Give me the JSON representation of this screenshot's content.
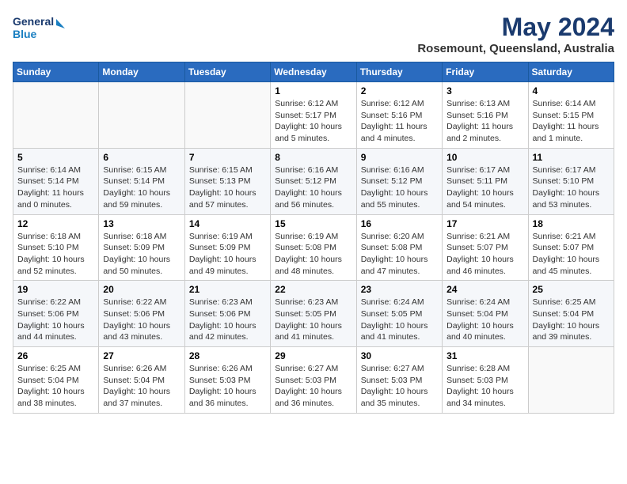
{
  "header": {
    "logo_line1": "General",
    "logo_line2": "Blue",
    "month_year": "May 2024",
    "location": "Rosemount, Queensland, Australia"
  },
  "days_of_week": [
    "Sunday",
    "Monday",
    "Tuesday",
    "Wednesday",
    "Thursday",
    "Friday",
    "Saturday"
  ],
  "weeks": [
    [
      {
        "day": "",
        "info": ""
      },
      {
        "day": "",
        "info": ""
      },
      {
        "day": "",
        "info": ""
      },
      {
        "day": "1",
        "info": "Sunrise: 6:12 AM\nSunset: 5:17 PM\nDaylight: 10 hours\nand 5 minutes."
      },
      {
        "day": "2",
        "info": "Sunrise: 6:12 AM\nSunset: 5:16 PM\nDaylight: 11 hours\nand 4 minutes."
      },
      {
        "day": "3",
        "info": "Sunrise: 6:13 AM\nSunset: 5:16 PM\nDaylight: 11 hours\nand 2 minutes."
      },
      {
        "day": "4",
        "info": "Sunrise: 6:14 AM\nSunset: 5:15 PM\nDaylight: 11 hours\nand 1 minute."
      }
    ],
    [
      {
        "day": "5",
        "info": "Sunrise: 6:14 AM\nSunset: 5:14 PM\nDaylight: 11 hours\nand 0 minutes."
      },
      {
        "day": "6",
        "info": "Sunrise: 6:15 AM\nSunset: 5:14 PM\nDaylight: 10 hours\nand 59 minutes."
      },
      {
        "day": "7",
        "info": "Sunrise: 6:15 AM\nSunset: 5:13 PM\nDaylight: 10 hours\nand 57 minutes."
      },
      {
        "day": "8",
        "info": "Sunrise: 6:16 AM\nSunset: 5:12 PM\nDaylight: 10 hours\nand 56 minutes."
      },
      {
        "day": "9",
        "info": "Sunrise: 6:16 AM\nSunset: 5:12 PM\nDaylight: 10 hours\nand 55 minutes."
      },
      {
        "day": "10",
        "info": "Sunrise: 6:17 AM\nSunset: 5:11 PM\nDaylight: 10 hours\nand 54 minutes."
      },
      {
        "day": "11",
        "info": "Sunrise: 6:17 AM\nSunset: 5:10 PM\nDaylight: 10 hours\nand 53 minutes."
      }
    ],
    [
      {
        "day": "12",
        "info": "Sunrise: 6:18 AM\nSunset: 5:10 PM\nDaylight: 10 hours\nand 52 minutes."
      },
      {
        "day": "13",
        "info": "Sunrise: 6:18 AM\nSunset: 5:09 PM\nDaylight: 10 hours\nand 50 minutes."
      },
      {
        "day": "14",
        "info": "Sunrise: 6:19 AM\nSunset: 5:09 PM\nDaylight: 10 hours\nand 49 minutes."
      },
      {
        "day": "15",
        "info": "Sunrise: 6:19 AM\nSunset: 5:08 PM\nDaylight: 10 hours\nand 48 minutes."
      },
      {
        "day": "16",
        "info": "Sunrise: 6:20 AM\nSunset: 5:08 PM\nDaylight: 10 hours\nand 47 minutes."
      },
      {
        "day": "17",
        "info": "Sunrise: 6:21 AM\nSunset: 5:07 PM\nDaylight: 10 hours\nand 46 minutes."
      },
      {
        "day": "18",
        "info": "Sunrise: 6:21 AM\nSunset: 5:07 PM\nDaylight: 10 hours\nand 45 minutes."
      }
    ],
    [
      {
        "day": "19",
        "info": "Sunrise: 6:22 AM\nSunset: 5:06 PM\nDaylight: 10 hours\nand 44 minutes."
      },
      {
        "day": "20",
        "info": "Sunrise: 6:22 AM\nSunset: 5:06 PM\nDaylight: 10 hours\nand 43 minutes."
      },
      {
        "day": "21",
        "info": "Sunrise: 6:23 AM\nSunset: 5:06 PM\nDaylight: 10 hours\nand 42 minutes."
      },
      {
        "day": "22",
        "info": "Sunrise: 6:23 AM\nSunset: 5:05 PM\nDaylight: 10 hours\nand 41 minutes."
      },
      {
        "day": "23",
        "info": "Sunrise: 6:24 AM\nSunset: 5:05 PM\nDaylight: 10 hours\nand 41 minutes."
      },
      {
        "day": "24",
        "info": "Sunrise: 6:24 AM\nSunset: 5:04 PM\nDaylight: 10 hours\nand 40 minutes."
      },
      {
        "day": "25",
        "info": "Sunrise: 6:25 AM\nSunset: 5:04 PM\nDaylight: 10 hours\nand 39 minutes."
      }
    ],
    [
      {
        "day": "26",
        "info": "Sunrise: 6:25 AM\nSunset: 5:04 PM\nDaylight: 10 hours\nand 38 minutes."
      },
      {
        "day": "27",
        "info": "Sunrise: 6:26 AM\nSunset: 5:04 PM\nDaylight: 10 hours\nand 37 minutes."
      },
      {
        "day": "28",
        "info": "Sunrise: 6:26 AM\nSunset: 5:03 PM\nDaylight: 10 hours\nand 36 minutes."
      },
      {
        "day": "29",
        "info": "Sunrise: 6:27 AM\nSunset: 5:03 PM\nDaylight: 10 hours\nand 36 minutes."
      },
      {
        "day": "30",
        "info": "Sunrise: 6:27 AM\nSunset: 5:03 PM\nDaylight: 10 hours\nand 35 minutes."
      },
      {
        "day": "31",
        "info": "Sunrise: 6:28 AM\nSunset: 5:03 PM\nDaylight: 10 hours\nand 34 minutes."
      },
      {
        "day": "",
        "info": ""
      }
    ]
  ]
}
